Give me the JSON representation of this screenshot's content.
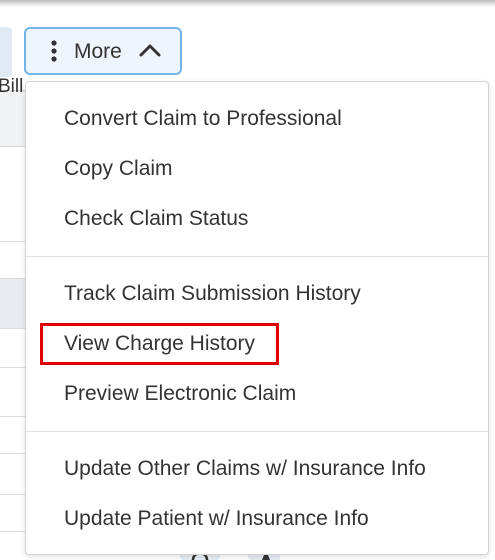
{
  "background": {
    "table_header_fragment": "Bill"
  },
  "more_button": {
    "label": "More",
    "kebab_icon": "kebab-vertical-icon",
    "chevron_icon": "chevron-up-icon",
    "border_color": "#74b4e8"
  },
  "menu": {
    "groups": [
      {
        "items": [
          "Convert Claim to Professional",
          "Copy Claim",
          "Check Claim Status"
        ]
      },
      {
        "items": [
          "Track Claim Submission History",
          "View Charge History",
          "Preview Electronic Claim"
        ]
      },
      {
        "items": [
          "Update Other Claims w/ Insurance Info",
          "Update Patient w/ Insurance Info"
        ]
      }
    ],
    "highlighted_item": "View Charge History",
    "highlight_color": "#e00000"
  }
}
